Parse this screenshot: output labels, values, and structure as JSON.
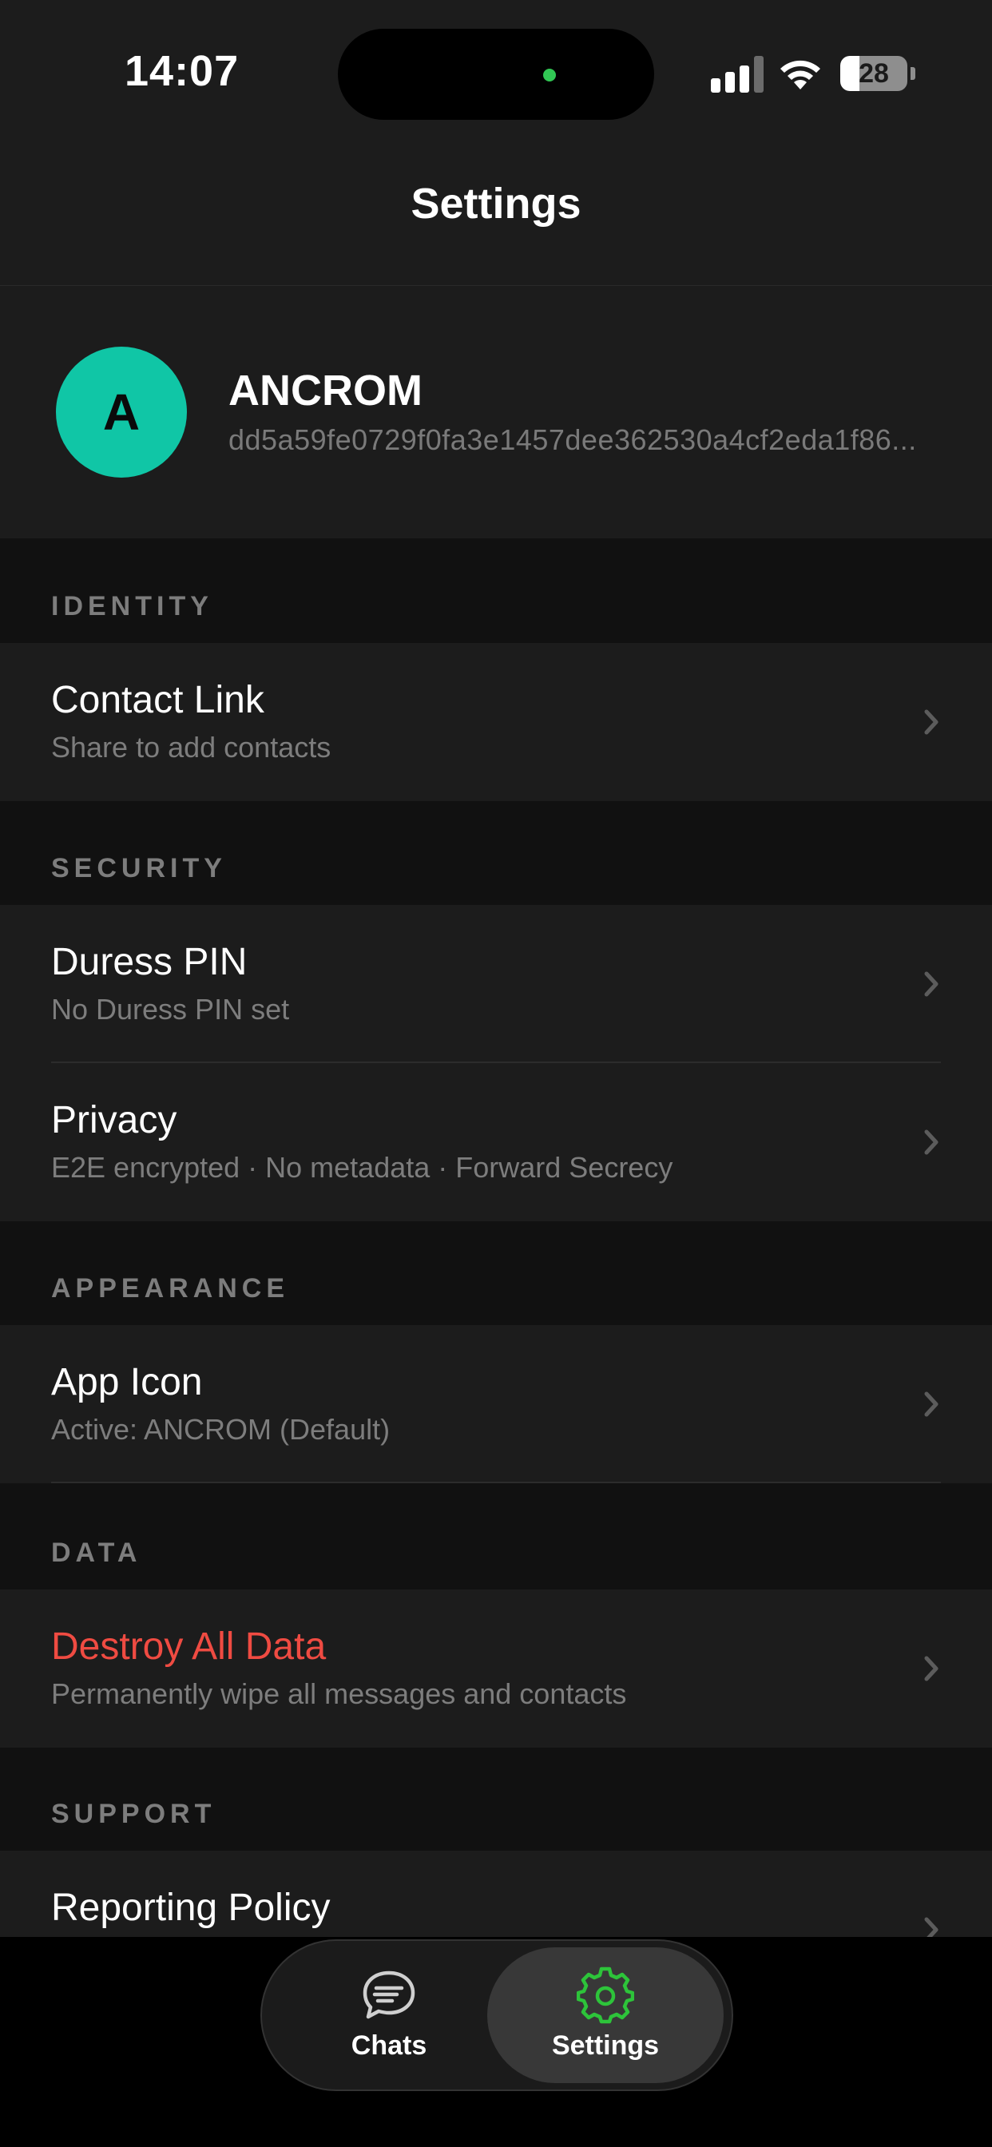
{
  "status_bar": {
    "time": "14:07",
    "battery_level": "28",
    "battery_fraction": 0.28
  },
  "nav": {
    "title": "Settings"
  },
  "profile": {
    "avatar_letter": "A",
    "avatar_color": "#10c6a6",
    "name": "ANCROM",
    "id": "dd5a59fe0729f0fa3e1457dee362530a4cf2eda1f86..."
  },
  "sections": {
    "identity": {
      "header": "IDENTITY",
      "contact_link": {
        "title": "Contact Link",
        "subtitle": "Share to add contacts"
      }
    },
    "security": {
      "header": "SECURITY",
      "duress_pin": {
        "title": "Duress PIN",
        "subtitle": "No Duress PIN set"
      },
      "privacy": {
        "title": "Privacy",
        "subtitle": "E2E encrypted · No metadata · Forward Secrecy"
      }
    },
    "appearance": {
      "header": "APPEARANCE",
      "app_icon": {
        "title": "App Icon",
        "subtitle": "Active: ANCROM (Default)"
      }
    },
    "data": {
      "header": "DATA",
      "destroy": {
        "title": "Destroy All Data",
        "subtitle": "Permanently wipe all messages and contacts",
        "color": "#ef4b42"
      }
    },
    "support": {
      "header": "SUPPORT",
      "reporting_policy": {
        "title": "Reporting Policy"
      }
    }
  },
  "tab_bar": {
    "tabs": [
      {
        "label": "Chats",
        "icon": "chat-bubble-icon",
        "active": false
      },
      {
        "label": "Settings",
        "icon": "gear-icon",
        "active": true
      }
    ],
    "active_color": "#2dc43a"
  }
}
